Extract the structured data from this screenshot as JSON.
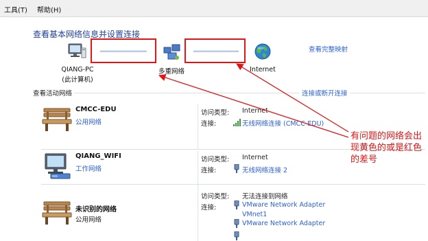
{
  "menu": {
    "tools": "工具(T)",
    "help": "帮助(H)"
  },
  "page_title": "查看基本网络信息并设置连接",
  "view_full_map": "查看完整映射",
  "map": {
    "computer_name": "QIANG-PC",
    "computer_sub": "(此计算机)",
    "multi_network": "多重网络",
    "internet": "Internet"
  },
  "active_networks_title": "查看活动网络",
  "connect_disconnect": "连接或断开连接",
  "labels": {
    "access_type": "访问类型:",
    "connections": "连接:"
  },
  "networks": [
    {
      "name": "CMCC-EDU",
      "type": "公用网络",
      "access": "Internet",
      "connections": [
        "无线网络连接 (CMCC-EDU)"
      ]
    },
    {
      "name": "QIANG_WIFI",
      "type": "工作网络",
      "access": "Internet",
      "connections": [
        "无线网络连接 2"
      ]
    },
    {
      "name": "未识别的网络",
      "type": "公用网络",
      "access": "无法连接到网络",
      "connections": [
        "VMware Network Adapter",
        "VMnet1",
        "VMware Network Adapter"
      ]
    }
  ],
  "annotation": "有问题的网络会出现黄色的或是红色的差号",
  "colors": {
    "accent_link": "#2b5fd6",
    "title": "#1f3f9d",
    "annotation_red": "#e21414"
  }
}
